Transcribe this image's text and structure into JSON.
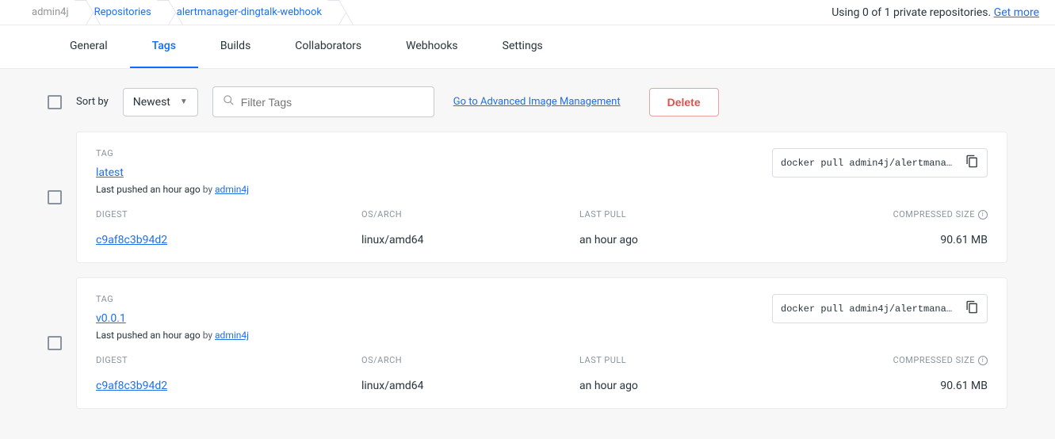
{
  "breadcrumb": {
    "owner": "admin4j",
    "section": "Repositories",
    "repo": "alertmanager-dingtalk-webhook"
  },
  "header": {
    "usage_text": "Using 0 of 1 private repositories.",
    "get_more": "Get more"
  },
  "tabs": {
    "general": "General",
    "tags": "Tags",
    "builds": "Builds",
    "collaborators": "Collaborators",
    "webhooks": "Webhooks",
    "settings": "Settings"
  },
  "controls": {
    "sort_label": "Sort by",
    "sort_value": "Newest",
    "filter_placeholder": "Filter Tags",
    "advanced_link": "Go to Advanced Image Management",
    "delete_label": "Delete"
  },
  "labels": {
    "tag": "TAG",
    "digest": "DIGEST",
    "os": "OS/ARCH",
    "last_pull": "LAST PULL",
    "size": "COMPRESSED SIZE"
  },
  "tags": [
    {
      "name": "latest",
      "pushed_prefix": "Last pushed ",
      "pushed_time": "an hour ago",
      "by": " by ",
      "author": "admin4j",
      "pull_cmd": "docker pull admin4j/alertmanager…",
      "digest": "c9af8c3b94d2",
      "os": "linux/amd64",
      "last_pull": "an hour ago",
      "size": "90.61 MB"
    },
    {
      "name": "v0.0.1",
      "pushed_prefix": "Last pushed ",
      "pushed_time": "an hour ago",
      "by": " by ",
      "author": "admin4j",
      "pull_cmd": "docker pull admin4j/alertmanager…",
      "digest": "c9af8c3b94d2",
      "os": "linux/amd64",
      "last_pull": "an hour ago",
      "size": "90.61 MB"
    }
  ]
}
